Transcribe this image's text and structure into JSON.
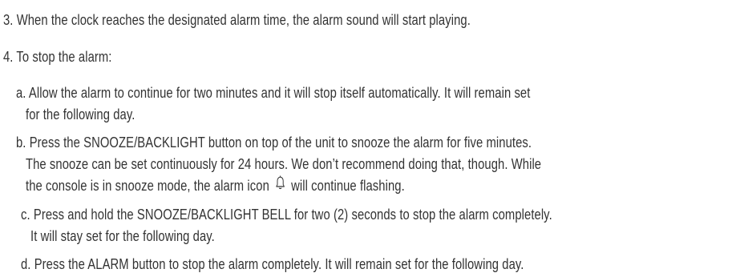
{
  "steps": {
    "step3": "3.  When the clock reaches the designated alarm time, the alarm sound will start playing.",
    "step4": "4.  To stop the alarm:"
  },
  "substeps": {
    "a_line1": "a. Allow the alarm to continue for two minutes and it will stop itself automatically. It will remain set",
    "a_line2": "for the following day.",
    "b_line1": "b. Press the SNOOZE/BACKLIGHT button on top of the unit to snooze the alarm for five minutes.",
    "b_line2": "The snooze can be set continuously for 24 hours. We don’t recommend doing that, though. While",
    "b_line3_before_icon": "the console is in snooze mode, the alarm icon",
    "b_line3_after_icon": "will continue flashing.",
    "c_line1": "c. Press and hold the SNOOZE/BACKLIGHT BELL for two (2) seconds to stop the alarm completely.",
    "c_line2": "It will stay set for the following day.",
    "d_line1": "d. Press the ALARM button to stop the alarm completely. It will remain set for the following day."
  },
  "icons": {
    "alarm_icon": "bell-icon"
  },
  "colors": {
    "text": "#333333",
    "background": "#ffffff"
  }
}
